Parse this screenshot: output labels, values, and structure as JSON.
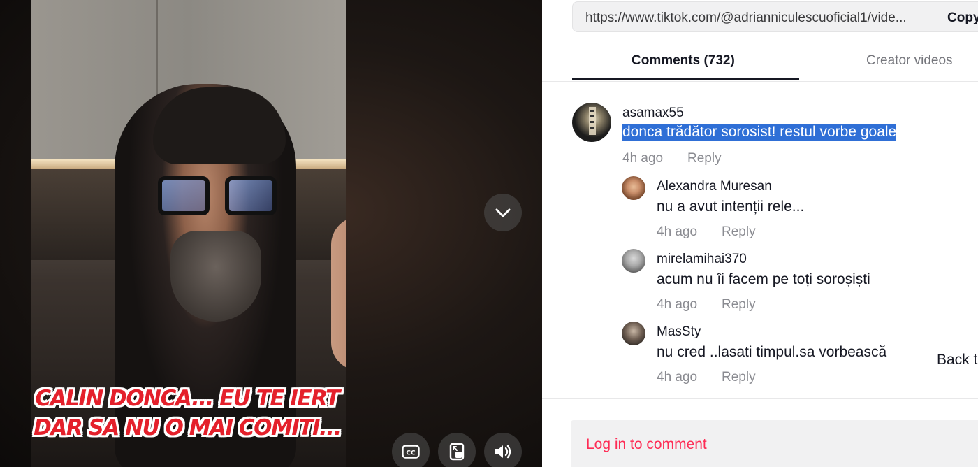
{
  "video": {
    "caption_line1": "CALIN DONCA... EU TE IERT",
    "caption_line2": "DAR SA NU O MAI COMITI...",
    "controls": [
      "chevron-down-icon",
      "captions-icon",
      "mini-player-icon",
      "volume-icon"
    ]
  },
  "url_bar": {
    "url": "https://www.tiktok.com/@adrianniculescuoficial1/vide...",
    "copy_label": "Copy"
  },
  "tabs": {
    "comments": "Comments (732)",
    "creator_videos": "Creator videos"
  },
  "comments": [
    {
      "username": "asamax55",
      "text": "donca trădător sorosist! restul vorbe goale",
      "time": "4h ago",
      "reply_label": "Reply",
      "replies": [
        {
          "username": "Alexandra Muresan",
          "text": "nu a avut intenții rele...",
          "time": "4h ago",
          "reply_label": "Reply"
        },
        {
          "username": "mirelamihai370",
          "text": "acum nu îi facem pe toți soroșiști",
          "time": "4h ago",
          "reply_label": "Reply"
        },
        {
          "username": "MasSty",
          "text": "nu cred ..lasati timpul.sa vorbească",
          "time": "4h ago",
          "reply_label": "Reply"
        }
      ]
    }
  ],
  "back_button": "Back t",
  "login": {
    "label": "Log in to comment"
  },
  "colors": {
    "accent": "#fe2c55",
    "selection": "#2f6fd6",
    "caption_red": "#e4202b"
  }
}
